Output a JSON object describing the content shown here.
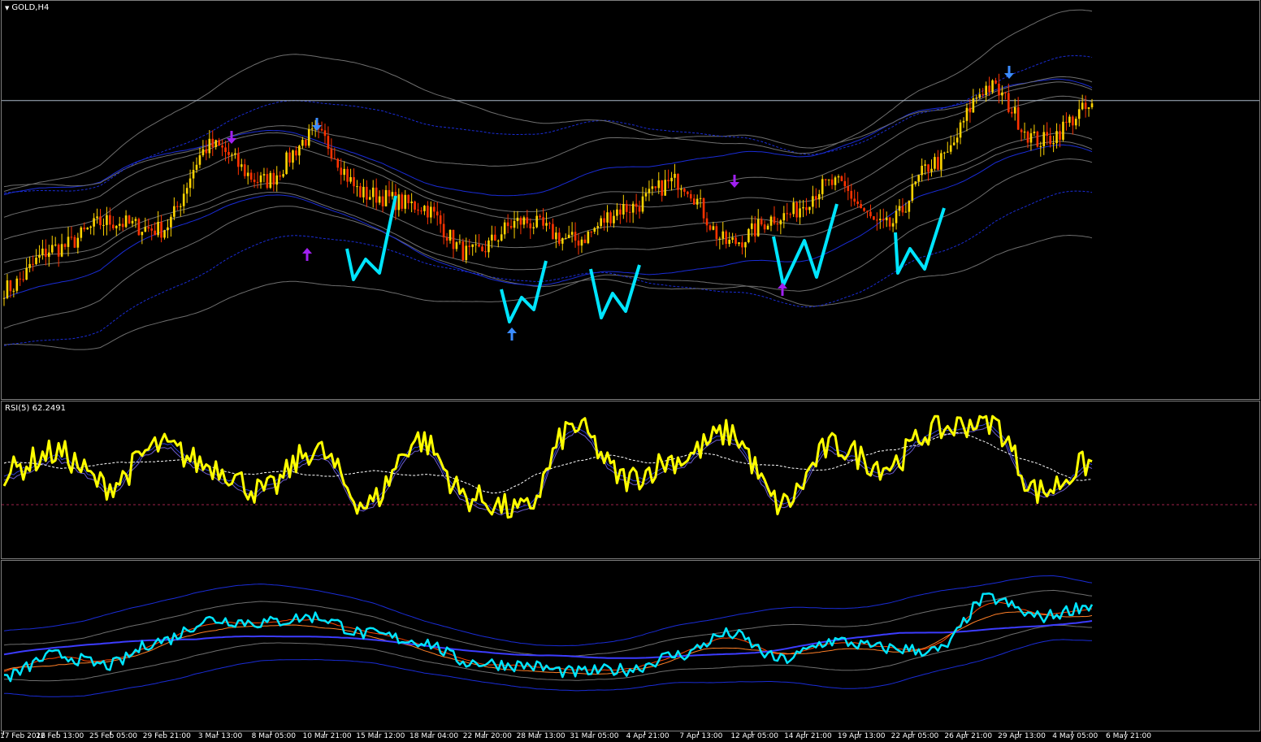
{
  "window": {
    "symbol_label": "GOLD,H4"
  },
  "rsi_pane": {
    "label": "RSI(5) 62.2491"
  },
  "colors": {
    "background": "#000000",
    "bull_candle": "#ffd400",
    "bear_candle": "#ff3300",
    "zigzag": "#00e5ff",
    "signal_down": "#3b8cff",
    "signal_purple": "#a020f0",
    "rsi_main": "#ffff00",
    "envelope_gray": "#6e6e6e",
    "envelope_blue": "#1a2cd6"
  },
  "chart_data": [
    {
      "type": "line",
      "title": "GOLD,H4",
      "x": [
        "17 Feb 2016",
        "22 Feb 13:00",
        "25 Feb 05:00",
        "29 Feb 21:00",
        "3 Mar 13:00",
        "8 Mar 05:00",
        "10 Mar 21:00",
        "15 Mar 12:00",
        "18 Mar 04:00",
        "22 Mar 20:00",
        "28 Mar 13:00",
        "31 Mar 05:00",
        "4 Apr 21:00",
        "7 Apr 13:00",
        "12 Apr 05:00",
        "14 Apr 21:00",
        "19 Apr 13:00",
        "22 Apr 05:00",
        "26 Apr 21:00",
        "29 Apr 13:00",
        "4 May 05:00",
        "6 May 21:00"
      ],
      "series": [
        {
          "values": [
            1215,
            1230,
            1240,
            1237,
            1268,
            1255,
            1272,
            1250,
            1246,
            1228,
            1240,
            1233,
            1245,
            1255,
            1232,
            1242,
            1254,
            1238,
            1262,
            1290,
            1270,
            1282
          ]
        }
      ],
      "ylim": [
        1180,
        1310
      ],
      "price_line": 1285,
      "signal_arrows": [
        "up-purple",
        "down-blue",
        "up-purple",
        "up-blue",
        "down-purple",
        "up-purple",
        "down-blue"
      ],
      "grid": false
    },
    {
      "type": "line",
      "title": "RSI(5) 62.2491",
      "x": [
        "17 Feb 2016",
        "22 Feb 13:00",
        "25 Feb 05:00",
        "29 Feb 21:00",
        "3 Mar 13:00",
        "8 Mar 05:00",
        "10 Mar 21:00",
        "15 Mar 12:00",
        "18 Mar 04:00",
        "22 Mar 20:00",
        "28 Mar 13:00",
        "31 Mar 05:00",
        "4 Apr 21:00",
        "7 Apr 13:00",
        "12 Apr 05:00",
        "14 Apr 21:00",
        "19 Apr 13:00",
        "22 Apr 05:00",
        "26 Apr 21:00",
        "29 Apr 13:00",
        "4 May 05:00",
        "6 May 21:00"
      ],
      "series": [
        {
          "values": [
            55,
            70,
            45,
            75,
            60,
            40,
            72,
            30,
            80,
            35,
            25,
            90,
            50,
            65,
            85,
            30,
            75,
            60,
            88,
            95,
            40,
            62
          ]
        }
      ],
      "ylim": [
        0,
        100
      ],
      "levels": [
        30
      ],
      "grid": false
    },
    {
      "type": "line",
      "x": [
        "17 Feb 2016",
        "22 Feb 13:00",
        "25 Feb 05:00",
        "29 Feb 21:00",
        "3 Mar 13:00",
        "8 Mar 05:00",
        "10 Mar 21:00",
        "15 Mar 12:00",
        "18 Mar 04:00",
        "22 Mar 20:00",
        "28 Mar 13:00",
        "31 Mar 05:00",
        "4 Apr 21:00",
        "7 Apr 13:00",
        "12 Apr 05:00",
        "14 Apr 21:00",
        "19 Apr 13:00",
        "22 Apr 05:00",
        "26 Apr 21:00",
        "29 Apr 13:00",
        "4 May 05:00",
        "6 May 21:00"
      ],
      "series": [
        {
          "values": [
            30,
            45,
            38,
            55,
            70,
            68,
            72,
            60,
            55,
            40,
            38,
            33,
            35,
            45,
            60,
            42,
            55,
            50,
            48,
            85,
            72,
            80
          ]
        }
      ],
      "ylim": [
        0,
        100
      ],
      "grid": false
    }
  ],
  "time_axis": {
    "labels": [
      "17 Feb 2016",
      "22 Feb 13:00",
      "25 Feb 05:00",
      "29 Feb 21:00",
      "3 Mar 13:00",
      "8 Mar 05:00",
      "10 Mar 21:00",
      "15 Mar 12:00",
      "18 Mar 04:00",
      "22 Mar 20:00",
      "28 Mar 13:00",
      "31 Mar 05:00",
      "4 Apr 21:00",
      "7 Apr 13:00",
      "12 Apr 05:00",
      "14 Apr 21:00",
      "19 Apr 13:00",
      "22 Apr 05:00",
      "26 Apr 21:00",
      "29 Apr 13:00",
      "4 May 05:00",
      "6 May 21:00"
    ]
  }
}
